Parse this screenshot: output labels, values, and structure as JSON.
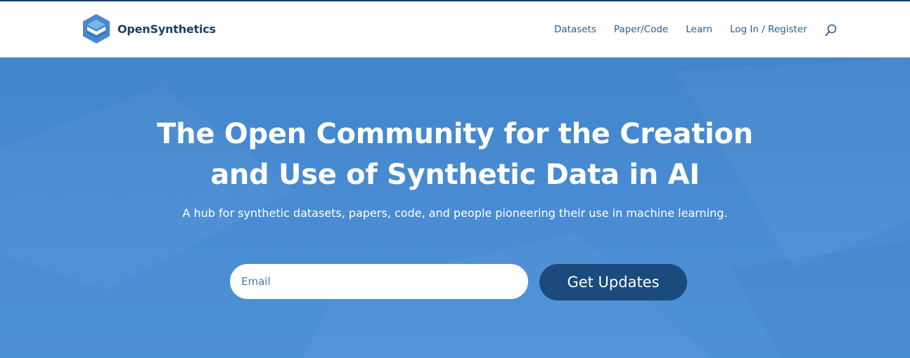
{
  "brand": {
    "name": "OpenSynthetics",
    "logo_icon": "hexagon-logo-icon",
    "logo_color": "#4a87cf"
  },
  "nav": {
    "items": [
      "Datasets",
      "Paper/Code",
      "Learn",
      "Log In / Register"
    ],
    "search_icon": "search-icon"
  },
  "hero": {
    "title_line1": "The Open Community for the Creation",
    "title_line2": "and Use of Synthetic Data in AI",
    "subtitle": "A hub for synthetic datasets, papers, code, and people pioneering their use in machine learning.",
    "email_placeholder": "Email",
    "cta_label": "Get Updates"
  },
  "colors": {
    "top_bar": "#16406b",
    "nav_text": "#2a5e91",
    "hero_bg": "#4689d1",
    "cta_bg": "#1b4a7d",
    "text_on_hero": "#ffffff"
  }
}
